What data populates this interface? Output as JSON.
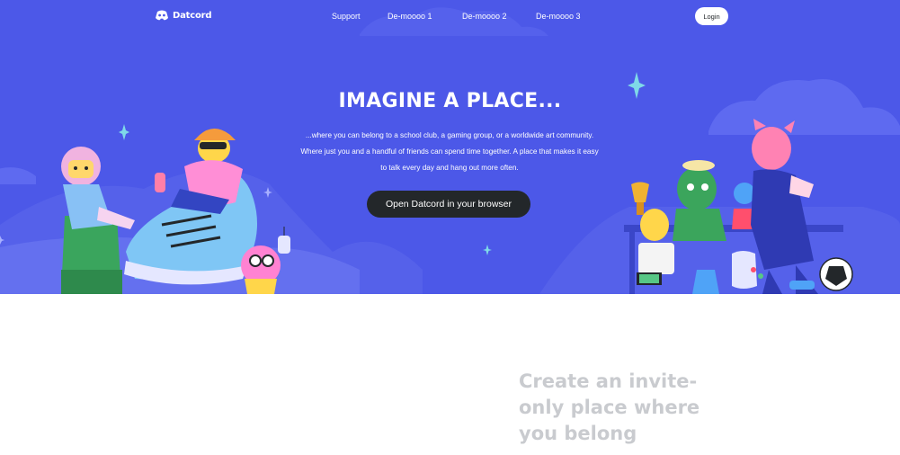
{
  "brand": {
    "name": "Datcord"
  },
  "nav": {
    "links": [
      "Support",
      "De-moooo 1",
      "De-moooo 2",
      "De-moooo 3"
    ],
    "login_label": "Login"
  },
  "hero": {
    "title": "IMAGINE A PLACE...",
    "subtitle_lines": [
      "...where you can belong to a school club, a gaming group, or a worldwide art community.",
      "Where just you and a handful of friends can spend time together. A place that makes it easy",
      "to talk every day and hang out more often."
    ],
    "cta_label": "Open Datcord in your browser"
  },
  "section": {
    "heading_lines": [
      "Create an invite-",
      "only place where",
      "you belong"
    ]
  },
  "colors": {
    "hero_bg": "#4c58e8",
    "cta_bg": "#23272a",
    "heading_gray": "#c9cbcf"
  }
}
